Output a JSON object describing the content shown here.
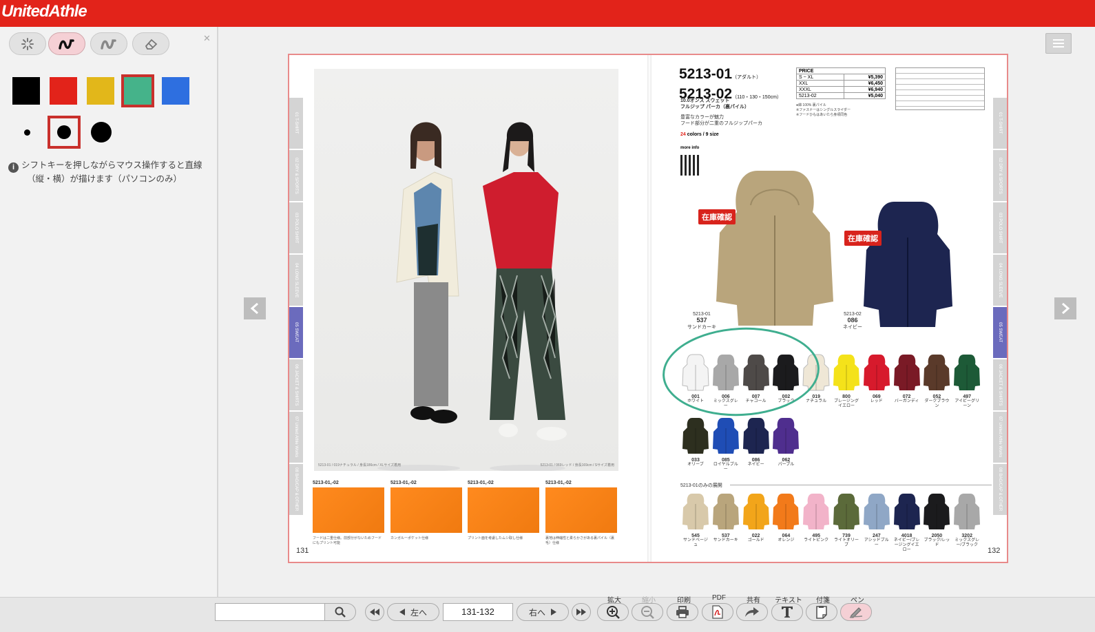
{
  "app": {
    "logo": "UnitedAthle"
  },
  "pen_panel": {
    "tools": [
      "spark-tool",
      "pen-tool",
      "highlighter-tool",
      "eraser-tool"
    ],
    "colors": [
      "#000000",
      "#e2231a",
      "#e2b71a",
      "#45b38a",
      "#2e6fe0"
    ],
    "selected_color": "#45b38a",
    "sizes": [
      "small",
      "medium",
      "large"
    ],
    "selected_size": "medium",
    "hint_line1": "シフトキーを押しながらマウス操作すると直線",
    "hint_line2": "（縦・横）が描けます（パソコンのみ）"
  },
  "catalog": {
    "left_tabs": [
      "01 T-SHIRT",
      "02 DRY & SPORTS",
      "03 POLO SHIRT",
      "04 LONG SLEEVE",
      "05 SWEAT",
      "06 JACKET & SHIRTS",
      "07 United Athle Works",
      "08 BAG/CAP & OTHER"
    ],
    "photo_caption_left": "5213-01 / 019ナチュラル / 身長186cm / XLサイズ着用",
    "photo_caption_right": "5213-01 / 069レッド / 身長169cm / Sサイズ着用",
    "thumb_labels": [
      "5213-01,-02",
      "5213-01,-02",
      "5213-01,-02",
      "5213-01,-02"
    ],
    "thumb_captions": [
      "フードは二重仕様。前部分がないためフードにもプリント可能",
      "カンガルーポケット仕様",
      "プリント面を考慮したムシ取し仕様",
      "裏地は伸縮性と柔らかさがある裏パイル（裏毛）仕様"
    ],
    "page_left": "131",
    "page_right": "132",
    "code_1": "5213-01",
    "code_1_sub": "（アダルト）",
    "code_2": "5213-02",
    "code_2_sub": "（110・130・150cm）",
    "product_name_1": "10.0オンス スウェット",
    "product_name_2": "フルジップ パーカ（裏パイル）",
    "tagline_1": "豊富なカラーが魅力",
    "tagline_2": "フード部分が二重のフルジップパーカ",
    "color_count": "24",
    "color_count_suffix": " colors / 9 size",
    "more_info": "more info",
    "price": {
      "header": "PRICE",
      "rows": [
        {
          "size": "S ~ XL",
          "price": "¥5,390"
        },
        {
          "size": "XXL",
          "price": "¥6,450"
        },
        {
          "size": "XXXL",
          "price": "¥6,940"
        },
        {
          "size": "5213-02",
          "price": "¥5,040"
        }
      ]
    },
    "notes_1": "●綿 100% 裏パイル",
    "notes_2": "※ファスナーはシングルスライダー",
    "notes_3": "※フードひもはあいたら身頃同色",
    "stock_label": "在庫確認",
    "feature_hoodies": [
      {
        "code": "5213-01",
        "num": "537",
        "name": "サンドカーキ",
        "color": "#b9a57c"
      },
      {
        "code": "5213-02",
        "num": "086",
        "name": "ネイビー",
        "color": "#1d2550"
      }
    ],
    "swatches_row1": [
      {
        "num": "001",
        "name": "ホワイト",
        "color": "#f4f4f4"
      },
      {
        "num": "006",
        "name": "ミックスグレー",
        "color": "#a8a8a8"
      },
      {
        "num": "007",
        "name": "チャコール",
        "color": "#4e4a48"
      },
      {
        "num": "002",
        "name": "ブラック",
        "color": "#1b1b1d"
      },
      {
        "num": "019",
        "name": "ナチュラル",
        "color": "#efe7d6"
      },
      {
        "num": "800",
        "name": "ブレージングイエロー",
        "color": "#f4e21a"
      },
      {
        "num": "069",
        "name": "レッド",
        "color": "#d71a2c"
      },
      {
        "num": "072",
        "name": "バーガンディ",
        "color": "#7a1a26"
      },
      {
        "num": "052",
        "name": "ダークブラウン",
        "color": "#5a3a2a"
      },
      {
        "num": "497",
        "name": "アイビーグリーン",
        "color": "#1d5a37"
      }
    ],
    "swatches_row2": [
      {
        "num": "033",
        "name": "オリーブ",
        "color": "#2d2f1f"
      },
      {
        "num": "085",
        "name": "ロイヤルブルー",
        "color": "#1f4db5"
      },
      {
        "num": "086",
        "name": "ネイビー",
        "color": "#1d2550"
      },
      {
        "num": "062",
        "name": "パープル",
        "color": "#4f2e8e"
      }
    ],
    "section_label": "5213-01のみの展開",
    "swatches_row3": [
      {
        "num": "545",
        "name": "サンドベージュ",
        "color": "#d8c9aa"
      },
      {
        "num": "537",
        "name": "サンドカーキ",
        "color": "#b9a57c"
      },
      {
        "num": "022",
        "name": "ゴールド",
        "color": "#f2a51a"
      },
      {
        "num": "064",
        "name": "オレンジ",
        "color": "#f27a1a"
      },
      {
        "num": "495",
        "name": "ライトピンク",
        "color": "#f2b3c9"
      },
      {
        "num": "739",
        "name": "ライトオリーブ",
        "color": "#5b6a3a"
      },
      {
        "num": "247",
        "name": "アシッドブルー",
        "color": "#8fa7c6"
      },
      {
        "num": "4018",
        "name": "ネイビー/ブレージングイエロー",
        "color": "#1d2550"
      },
      {
        "num": "2050",
        "name": "ブラック/レッド",
        "color": "#1b1b1d"
      },
      {
        "num": "3202",
        "name": "ミックスグレー/ブラック",
        "color": "#a8a8a8"
      }
    ]
  },
  "bottom": {
    "search_value": "",
    "prev_label": "左へ",
    "next_label": "右へ",
    "page_value": "131-132",
    "labels": {
      "zoom_in": "拡大",
      "zoom_out": "縮小",
      "print": "印刷",
      "pdf": "PDF",
      "share": "共有",
      "text": "テキスト",
      "sticky": "付箋",
      "pen": "ペン"
    }
  }
}
